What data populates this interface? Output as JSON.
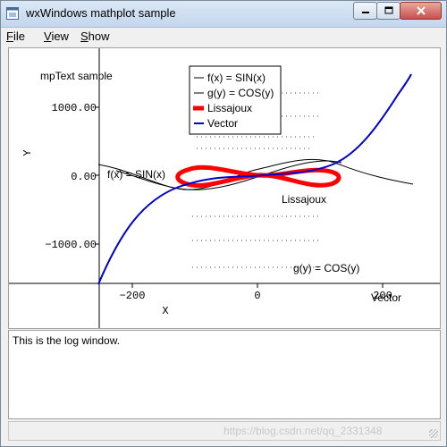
{
  "window": {
    "title": "wxWindows mathplot sample"
  },
  "menu": {
    "file": {
      "accel": "F",
      "rest": "ile"
    },
    "view": {
      "accel": "V",
      "rest": "iew"
    },
    "show": {
      "accel": "S",
      "rest": "how"
    }
  },
  "plot": {
    "mptext": "mpText sample",
    "axis_x_label": "X",
    "axis_y_label": "Y",
    "y_ticks": [
      "1000.00",
      "0.00",
      "−1000.00"
    ],
    "x_ticks": [
      "−200",
      "0",
      "200"
    ],
    "legend": [
      {
        "label": "f(x) = SIN(x)",
        "color": "#000000"
      },
      {
        "label": "g(y) = COS(y)",
        "color": "#000000"
      },
      {
        "label": "Lissajoux",
        "color": "#ff0000"
      },
      {
        "label": "Vector",
        "color": "#0000cc"
      }
    ],
    "labels": {
      "sin": "f(x) = SIN(x)",
      "lissajoux": "Lissajoux",
      "cos": "g(y) = COS(y)",
      "vector": "Vector"
    }
  },
  "log": {
    "text": "This is the log window."
  },
  "status": {
    "watermark": "https://blog.csdn.net/qq_2331348"
  }
}
